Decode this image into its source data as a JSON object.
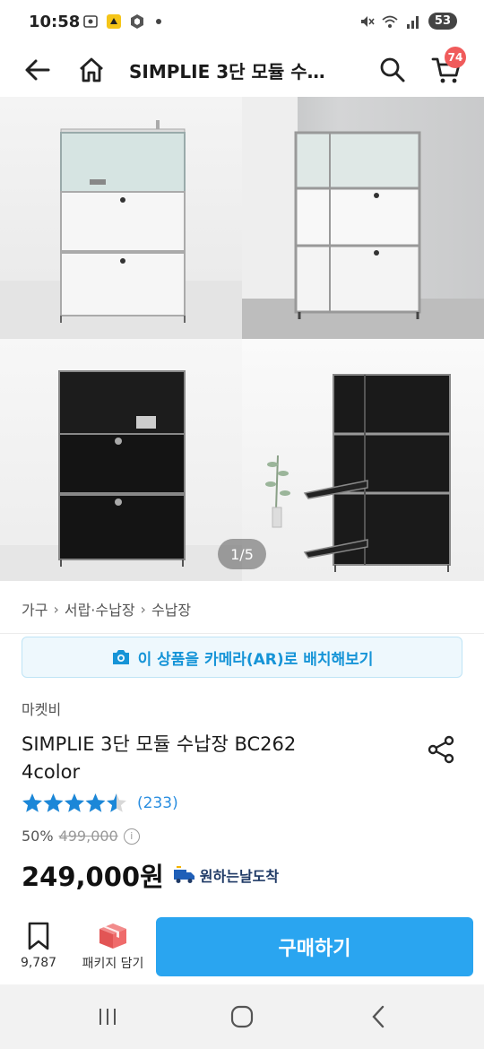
{
  "status_bar": {
    "time": "10:58",
    "battery": "53"
  },
  "header": {
    "title": "SIMPLIE 3단 모듈 수…",
    "cart_count": "74"
  },
  "gallery": {
    "page_indicator": "1/5"
  },
  "breadcrumb": [
    "가구",
    "서랍·수납장",
    "수납장"
  ],
  "ar_button": {
    "label": "이 상품을 카메라(AR)로 배치해보기"
  },
  "product": {
    "brand": "마켓비",
    "title_line1": "SIMPLIE 3단 모듈 수납장 BC262",
    "title_line2": "4color",
    "rating": 4.5,
    "review_count": "(233)",
    "discount": "50%",
    "original_price": "499,000",
    "sale_price": "249,000원",
    "delivery_label": "원하는날도착"
  },
  "action_bar": {
    "bookmark_count": "9,787",
    "package_label": "패키지 담기",
    "buy_label": "구매하기"
  },
  "colors": {
    "accent": "#2aa5f0",
    "link": "#2a8ee0",
    "star": "#1b87d8",
    "badge": "#f05b5b"
  }
}
